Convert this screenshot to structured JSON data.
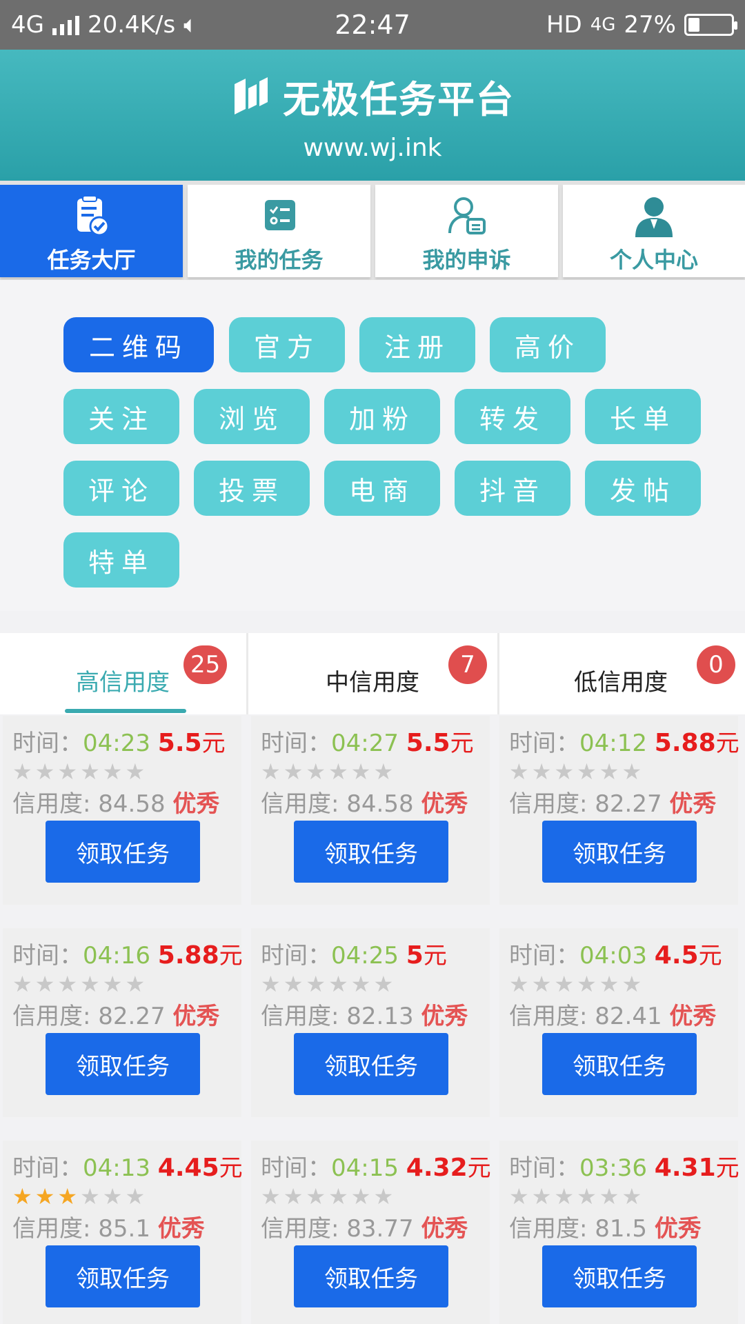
{
  "status_bar": {
    "network": "4G",
    "speed": "20.4K/s",
    "time": "22:47",
    "hd": "HD",
    "network_right": "4G",
    "battery": "27%",
    "battery_level": 0.27
  },
  "header": {
    "title": "无极任务平台",
    "url": "www.wj.ink",
    "bg_color": "#2aa0a8"
  },
  "nav": [
    {
      "label": "任务大厅",
      "icon": "task-hall-icon"
    },
    {
      "label": "我的任务",
      "icon": "task-list-icon"
    },
    {
      "label": "我的申诉",
      "icon": "appeal-icon"
    },
    {
      "label": "个人中心",
      "icon": "user-center-icon"
    }
  ],
  "chips": [
    "二维码",
    "官方",
    "注册",
    "高价",
    "关注",
    "浏览",
    "加粉",
    "转发",
    "长单",
    "评论",
    "投票",
    "电商",
    "抖音",
    "发帖",
    "特单"
  ],
  "credit_tabs": [
    {
      "label": "高信用度",
      "count": "25"
    },
    {
      "label": "中信用度",
      "count": "7"
    },
    {
      "label": "低信用度",
      "count": "0"
    }
  ],
  "labels": {
    "time": "时间：",
    "credit": "信用度: ",
    "unit": "元",
    "grade": "优秀",
    "button": "领取任务"
  },
  "tasks": [
    {
      "time": "04:23",
      "price": "5.5",
      "stars": 0,
      "credit": "84.58"
    },
    {
      "time": "04:27",
      "price": "5.5",
      "stars": 0,
      "credit": "84.58"
    },
    {
      "time": "04:12",
      "price": "5.88",
      "stars": 0,
      "credit": "82.27"
    },
    {
      "time": "04:16",
      "price": "5.88",
      "stars": 0,
      "credit": "82.27"
    },
    {
      "time": "04:25",
      "price": "5",
      "stars": 0,
      "credit": "82.13"
    },
    {
      "time": "04:03",
      "price": "4.5",
      "stars": 0,
      "credit": "82.41"
    },
    {
      "time": "04:13",
      "price": "4.45",
      "stars": 3,
      "credit": "85.1"
    },
    {
      "time": "04:15",
      "price": "4.32",
      "stars": 0,
      "credit": "83.77"
    },
    {
      "time": "03:36",
      "price": "4.31",
      "stars": 0,
      "credit": "81.5"
    }
  ]
}
